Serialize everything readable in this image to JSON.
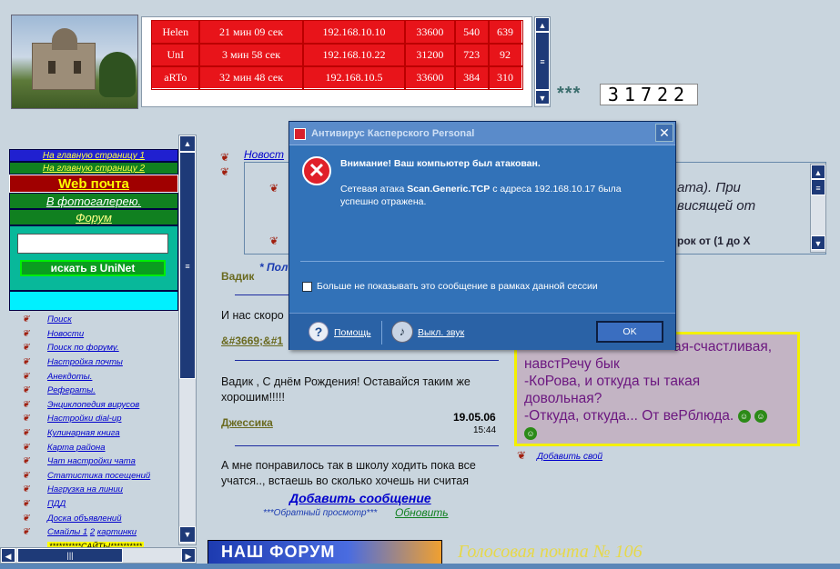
{
  "users": [
    {
      "name": "Helen",
      "time": "21 мин 09 сек",
      "ip": "192.168.10.10",
      "port": "33600",
      "a": "540",
      "b": "639"
    },
    {
      "name": "UnI",
      "time": "3 мин 58 сек",
      "ip": "192.168.10.22",
      "port": "31200",
      "a": "723",
      "b": "92"
    },
    {
      "name": "aRTo",
      "time": "32 мин 48 сек",
      "ip": "192.168.10.5",
      "port": "33600",
      "a": "384",
      "b": "310"
    }
  ],
  "stars": "***",
  "counter": "31722",
  "nav": {
    "home1": "На главную страницу 1",
    "home2": "На главную страницу 2",
    "webmail": "Web почта",
    "gallery": "В фотогалерею.",
    "forum": "Форум",
    "search_button": "искать в UniNet"
  },
  "links": [
    "Поиск",
    "Новости",
    "Поиск по форуму.",
    "Настройка почты",
    "Анекдоты.",
    "Рефераты.",
    "Энциклопедия вирусов",
    "Настройки dial-up",
    "Кулинарная книга",
    "Карта района",
    "Чат настройки чата",
    "Статистика посещений",
    "Нагрузка на линии",
    "ПДД",
    "Доска объявлений"
  ],
  "links_smiles": {
    "label": "Смайлы 1",
    "num": "2",
    "pics": "картинки"
  },
  "links_sites": "**********САЙТЫ**********",
  "guestbook": {
    "news": "Новост",
    "right_text1": "ата). При",
    "right_text2": "висящей от",
    "right_text3": "рок от (1 до X",
    "pol": "* Пол",
    "vadik": "Вадик",
    "msg1": "И нас скоро",
    "msg1_author": "&#3669;&#1",
    "msg2": "Вадик , С днём Рождения! Оставайся таким же хорошим!!!!!",
    "msg2_author": "Джессика",
    "msg2_date": "19.05.06",
    "msg2_time": "15:44",
    "msg3": "А мне понравилось так в школу ходить пока все учатся.., встаешь во сколько хочешь ни считая",
    "add": "Добавить сообщение",
    "reverse": "***Обратный просмотр***",
    "refresh": "Обновить"
  },
  "joke": {
    "l1": "ая-счастливая,",
    "l2": "навстРечу бык",
    "l3": "-КоРова, и откуда ты такая",
    "l4": "довольная?",
    "l5": "-Откуда, откуда... От веРблюда.",
    "add": "Добавить свой"
  },
  "forum_banner": "НАШ ФОРУМ",
  "voicemail": "Голосовая почта № 106",
  "dialog": {
    "title": "Антивирус Касперского Personal",
    "heading": "Внимание! Ваш компьютер был атакован.",
    "body_prefix": "Сетевая атака ",
    "body_attack": "Scan.Generic.TCP",
    "body_suffix": " с адреса 192.168.10.17 была успешно отражена.",
    "checkbox": "Больше не показывать это сообщение в рамках данной сессии",
    "help": "Помощь",
    "sound": "Выкл. звук",
    "ok": "OK"
  },
  "colors": {
    "table_red": "#e8141a",
    "dialog_blue": "#3272b8",
    "joke_bg": "#c3b4c4",
    "joke_border": "#f4f000"
  }
}
